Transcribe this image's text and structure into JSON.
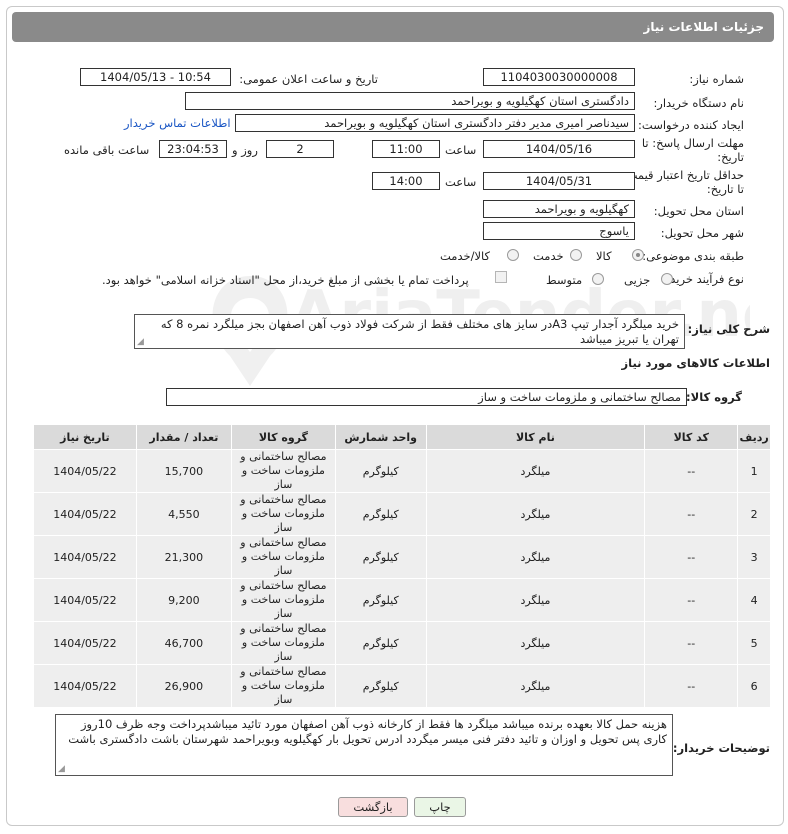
{
  "header": {
    "title": "جزئیات اطلاعات نیاز"
  },
  "fields": {
    "need_number": {
      "label": "شماره نیاز:",
      "value": "1104030030000008"
    },
    "announce_datetime": {
      "label": "تاریخ و ساعت اعلان عمومی:",
      "value": "1404/05/13 - 10:54"
    },
    "buyer_org": {
      "label": "نام دستگاه خریدار:",
      "value": "دادگستری استان کهگیلویه و بویراحمد"
    },
    "creator": {
      "label": "ایجاد کننده درخواست:",
      "value": "سیدناصر امیری مدیر دفتر دادگستری استان کهگیلویه و بویراحمد",
      "contact_link": "اطلاعات تماس خریدار"
    },
    "reply_deadline": {
      "label_line1": "مهلت ارسال پاسخ: تا",
      "label_line2": "تاریخ:",
      "date": "1404/05/16",
      "time_label": "ساعت",
      "time": "11:00",
      "days": "2",
      "days_label": "روز و",
      "remaining": "23:04:53",
      "remaining_label": "ساعت باقی مانده"
    },
    "price_validity": {
      "label_line1": "حداقل تاریخ اعتبار قیمت:",
      "label_line2": "تا تاریخ:",
      "date": "1404/05/31",
      "time_label": "ساعت",
      "time": "14:00"
    },
    "delivery_province": {
      "label": "استان محل تحویل:",
      "value": "کهگیلویه و بویراحمد"
    },
    "delivery_city": {
      "label": "شهر محل تحویل:",
      "value": "یاسوج"
    },
    "category": {
      "label": "طبقه بندی موضوعی:",
      "options": [
        "کالا",
        "خدمت",
        "کالا/خدمت"
      ],
      "selected": "کالا"
    },
    "purchase_process": {
      "label": "نوع فرآیند خرید :",
      "options": [
        "جزیی",
        "متوسط"
      ],
      "selected": "",
      "payment_note": "پرداخت تمام یا بخشی از مبلغ خرید،از محل \"اسناد خزانه اسلامی\" خواهد بود."
    }
  },
  "description": {
    "label": "شرح کلی نیاز:",
    "text": "خرید میلگرد آجدار تیپ A3در سایز های مختلف فقط از شرکت فولاد ذوب آهن اصفهان بجز میلگرد نمره 8 که تهران یا تبریز میباشد"
  },
  "goods_section": {
    "title": "اطلاعات کالاهای مورد نیاز",
    "group_label": "گروه کالا:",
    "group_value": "مصالح ساختمانی و ملزومات ساخت و ساز"
  },
  "table": {
    "headers": [
      "ردیف",
      "کد کالا",
      "نام کالا",
      "واحد شمارش",
      "گروه کالا",
      "تعداد / مقدار",
      "تاریخ نیاز"
    ],
    "rows": [
      {
        "idx": "1",
        "code": "--",
        "name": "میلگرد",
        "unit": "کیلوگرم",
        "group": "مصالح ساختمانی و ملزومات ساخت و ساز",
        "qty": "15,700",
        "date": "1404/05/22"
      },
      {
        "idx": "2",
        "code": "--",
        "name": "میلگرد",
        "unit": "کیلوگرم",
        "group": "مصالح ساختمانی و ملزومات ساخت و ساز",
        "qty": "4,550",
        "date": "1404/05/22"
      },
      {
        "idx": "3",
        "code": "--",
        "name": "میلگرد",
        "unit": "کیلوگرم",
        "group": "مصالح ساختمانی و ملزومات ساخت و ساز",
        "qty": "21,300",
        "date": "1404/05/22"
      },
      {
        "idx": "4",
        "code": "--",
        "name": "میلگرد",
        "unit": "کیلوگرم",
        "group": "مصالح ساختمانی و ملزومات ساخت و ساز",
        "qty": "9,200",
        "date": "1404/05/22"
      },
      {
        "idx": "5",
        "code": "--",
        "name": "میلگرد",
        "unit": "کیلوگرم",
        "group": "مصالح ساختمانی و ملزومات ساخت و ساز",
        "qty": "46,700",
        "date": "1404/05/22"
      },
      {
        "idx": "6",
        "code": "--",
        "name": "میلگرد",
        "unit": "کیلوگرم",
        "group": "مصالح ساختمانی و ملزومات ساخت و ساز",
        "qty": "26,900",
        "date": "1404/05/22"
      }
    ]
  },
  "buyer_notes": {
    "label": "توضیحات خریدار:",
    "text": "هزینه حمل کالا بعهده برنده میباشد میلگرد ها فقط از کارخانه ذوب آهن اصفهان مورد تائید میباشدپرداخت وجه ظرف 10روز کاری پس تحویل و اوزان و تائید دفتر فنی میسر میگردد ادرس تحویل بار کهگیلویه وبویراحمد شهرستان باشت دادگستری باشت"
  },
  "buttons": {
    "print": "چاپ",
    "back": "بازگشت"
  },
  "watermark": {
    "text": "AriaTender.neT"
  },
  "colors": {
    "header_bg": "#8a8a8a",
    "link": "#1a56c4",
    "table_header": "#dadada",
    "table_cell": "#eeeeee",
    "back_button_bg": "#f8dede",
    "print_button_bg": "#eaf6e6"
  }
}
